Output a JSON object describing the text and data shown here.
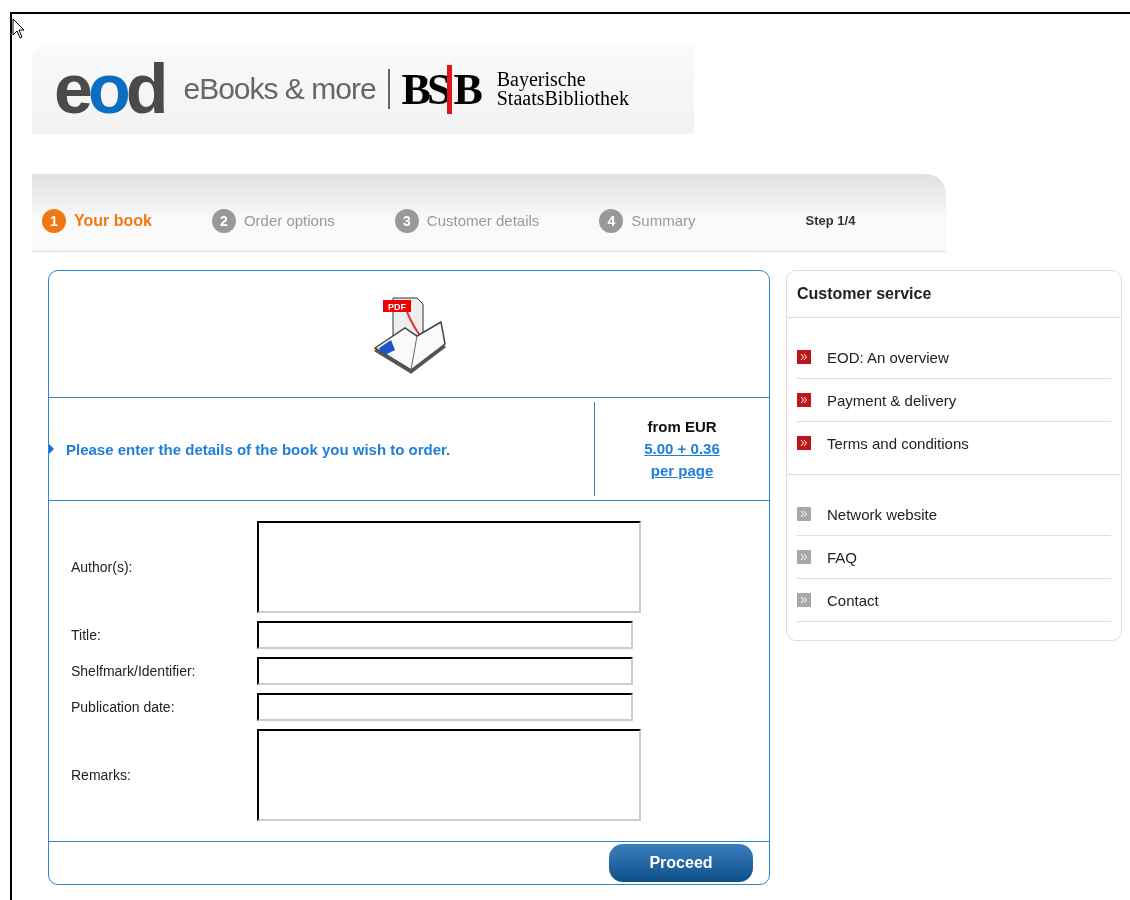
{
  "header": {
    "logo": "eod",
    "tagline": "eBooks & more",
    "library_mark": "BSB",
    "library_name": [
      "Bayerische",
      "StaatsBibliothek"
    ]
  },
  "steps": [
    {
      "number": "1",
      "label": "Your book",
      "selected": true
    },
    {
      "number": "2",
      "label": "Order options",
      "selected": false
    },
    {
      "number": "3",
      "label": "Customer details",
      "selected": false
    },
    {
      "number": "4",
      "label": "Summary",
      "selected": false
    }
  ],
  "step_counter": "Step 1/4",
  "order_form": {
    "icon_label": "PDF",
    "instruction": "Please enter the details of the book you wish to order.",
    "price": {
      "label": "from EUR",
      "link_lines": [
        "5.00 + 0.36",
        "per page"
      ]
    },
    "fields": [
      {
        "label": "Author(s):",
        "kind": "textarea"
      },
      {
        "label": "Title:",
        "kind": "text"
      },
      {
        "label": "Shelfmark/Identifier:",
        "kind": "text"
      },
      {
        "label": "Publication date:",
        "kind": "text"
      },
      {
        "label": "Remarks:",
        "kind": "textarea"
      }
    ],
    "submit": "Proceed"
  },
  "sidebar": {
    "title": "Customer service",
    "groups": [
      {
        "highlighted": true,
        "items": [
          "EOD: An overview",
          "Payment & delivery",
          "Terms and conditions"
        ]
      },
      {
        "highlighted": false,
        "items": [
          "Network website",
          "FAQ",
          "Contact"
        ]
      }
    ]
  }
}
